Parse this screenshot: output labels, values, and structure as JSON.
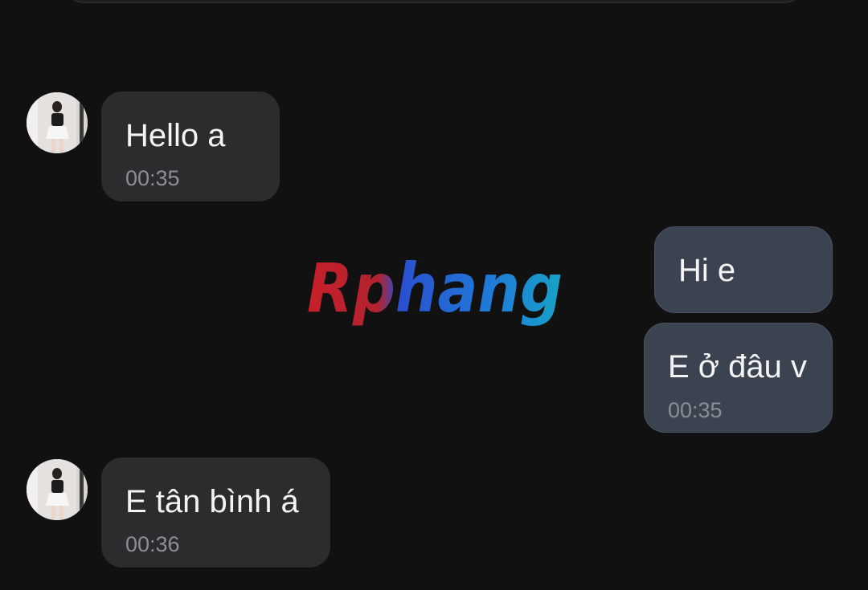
{
  "watermark": {
    "text": "Rphang"
  },
  "colors": {
    "background": "#111112",
    "incoming_bubble": "#2c2c2e",
    "outgoing_bubble": "#3c4350",
    "message_text": "#f4f4f6",
    "timestamp_text": "#8b8e94",
    "watermark_red": "#c8202a",
    "watermark_blue": "#1f7fd8"
  },
  "messages": [
    {
      "direction": "incoming",
      "text": "Hello a",
      "time": "00:35",
      "avatar_icon": "contact-avatar"
    },
    {
      "direction": "outgoing",
      "text": "Hi e",
      "time": ""
    },
    {
      "direction": "outgoing",
      "text": "E ở đâu v",
      "time": "00:35"
    },
    {
      "direction": "incoming",
      "text": "E tân bình á",
      "time": "00:36",
      "avatar_icon": "contact-avatar"
    }
  ]
}
